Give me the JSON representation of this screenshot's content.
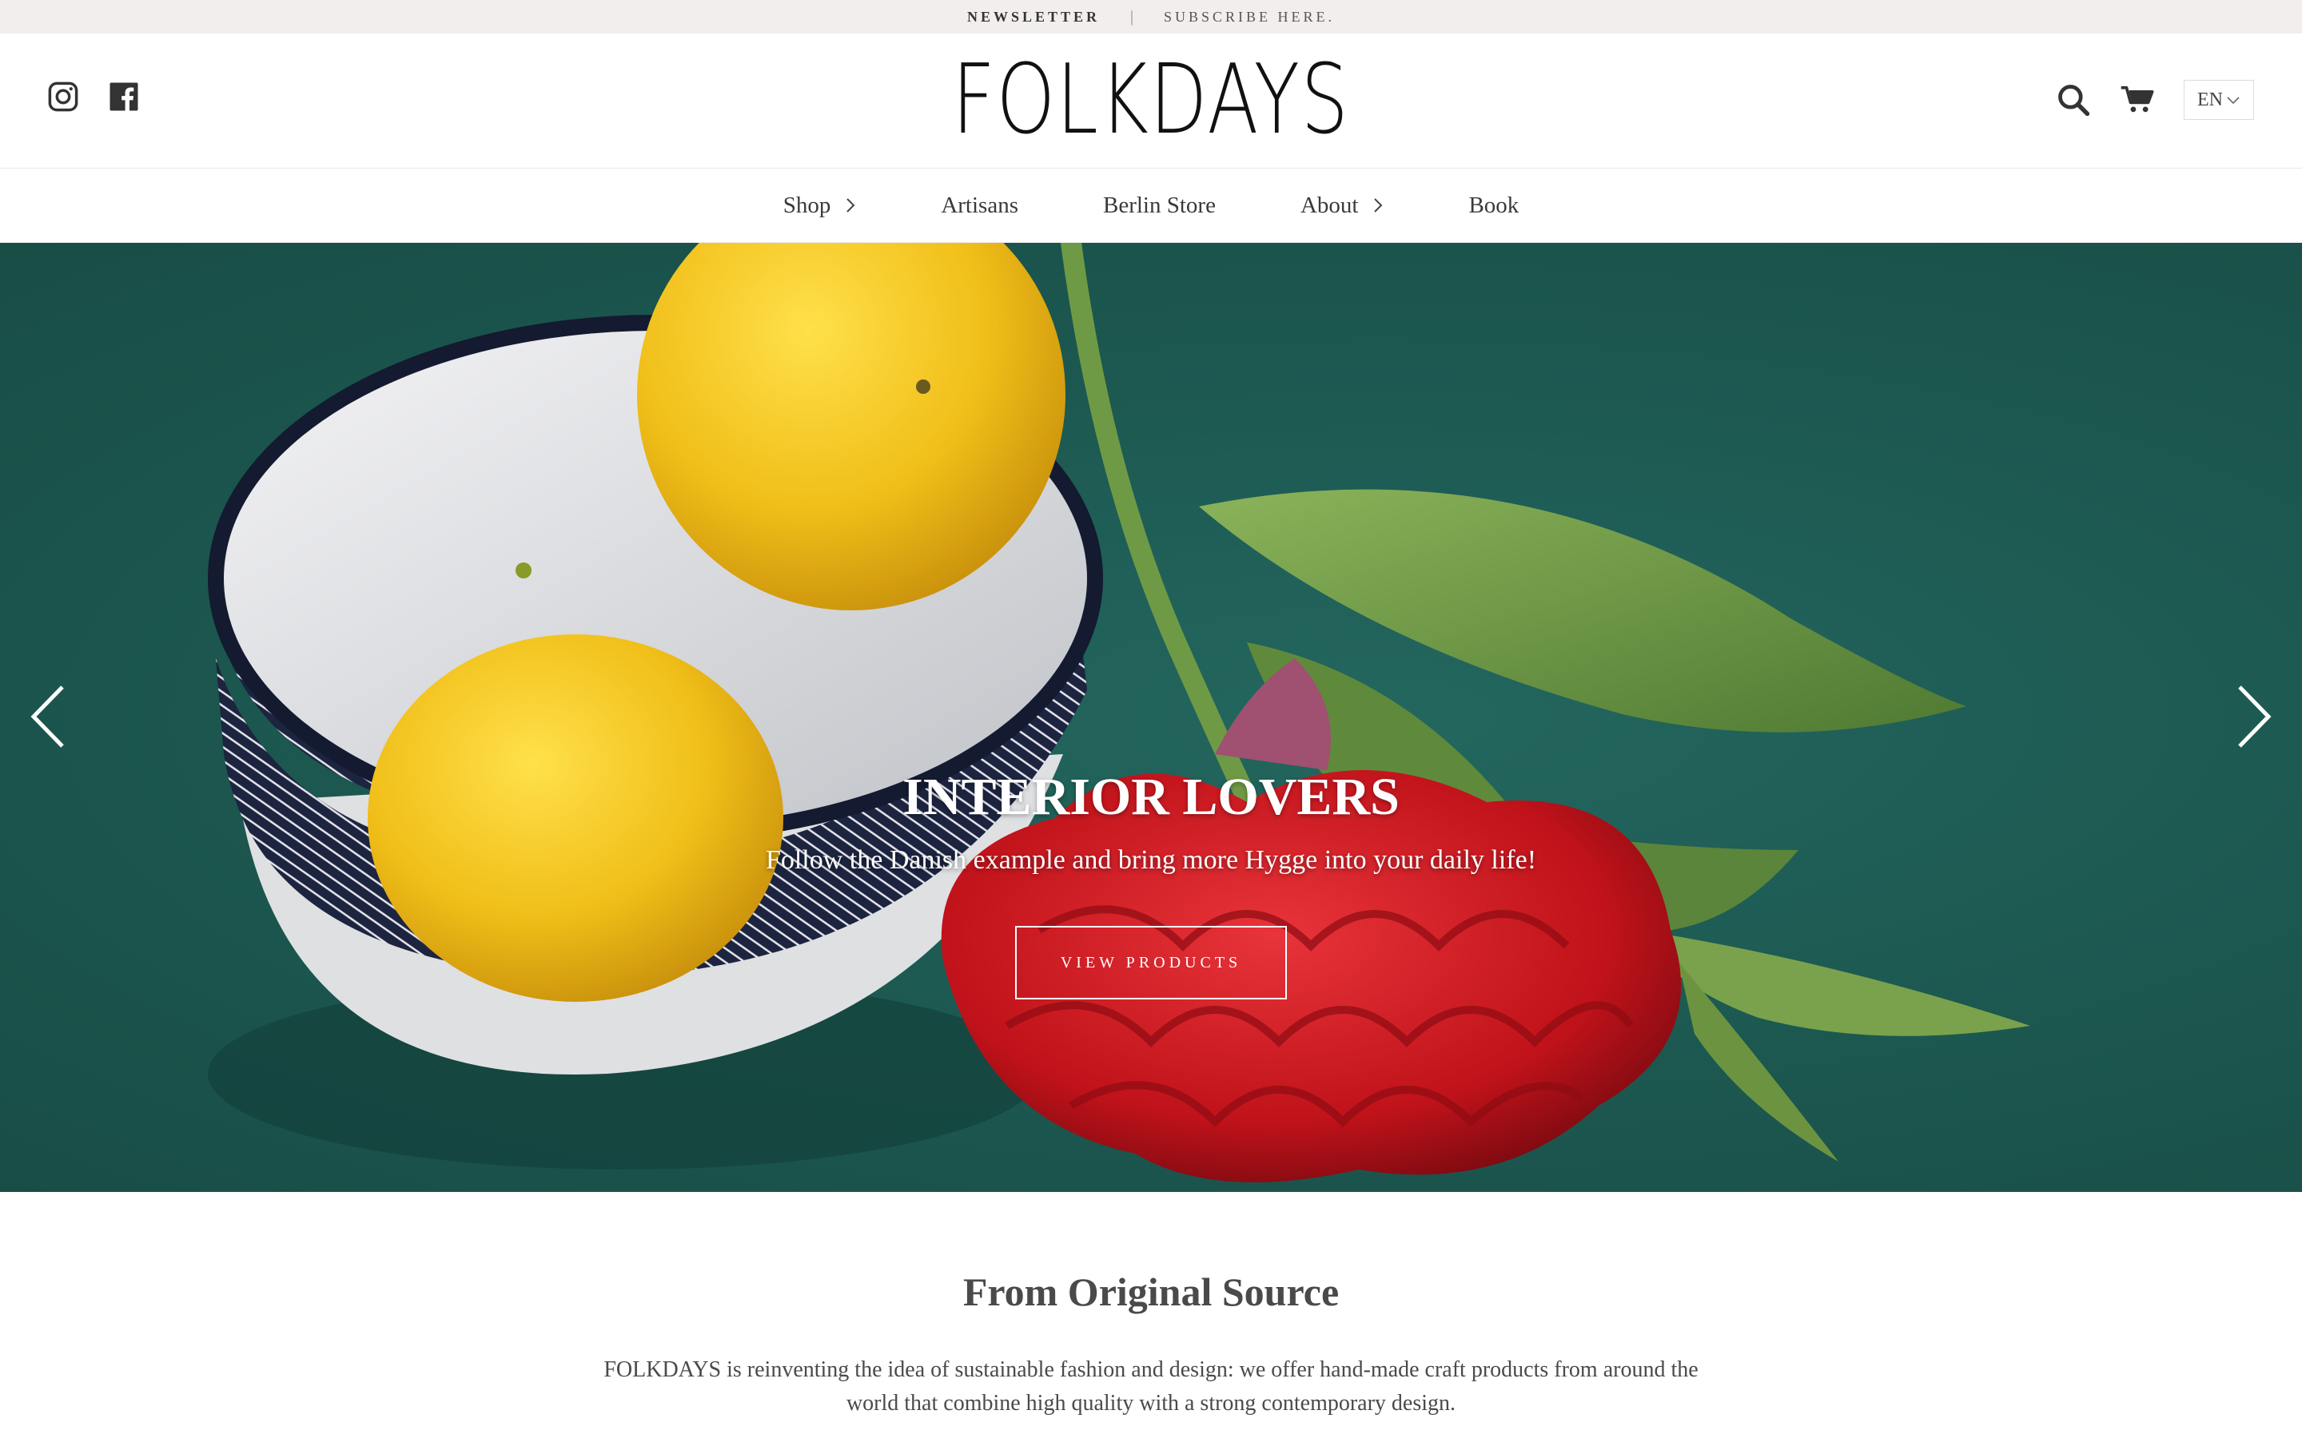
{
  "announcement": {
    "newsletter": "NEWSLETTER",
    "separator": "|",
    "subscribe": "SUBSCRIBE HERE."
  },
  "header": {
    "logo_text": "FOLKDAYS",
    "social": [
      {
        "icon": "instagram-icon"
      },
      {
        "icon": "facebook-icon"
      }
    ],
    "actions": {
      "search_icon": "search-icon",
      "cart_icon": "cart-icon",
      "language": "EN"
    }
  },
  "nav": {
    "items": [
      {
        "label": "Shop",
        "has_submenu": true
      },
      {
        "label": "Artisans",
        "has_submenu": false
      },
      {
        "label": "Berlin Store",
        "has_submenu": false
      },
      {
        "label": "About",
        "has_submenu": true
      },
      {
        "label": "Book",
        "has_submenu": false
      }
    ]
  },
  "hero": {
    "title": "INTERIOR LOVERS",
    "subtitle": "Follow the Danish example and bring more Hygge into your daily life!",
    "button": "VIEW PRODUCTS",
    "colors": {
      "background": "#1f5d55",
      "lemon": "#f2c21b",
      "flower": "#c8161c",
      "leaf": "#6f9a45"
    }
  },
  "intro": {
    "title": "From Original Source",
    "text": "FOLKDAYS is reinventing the idea of sustainable fashion and design: we offer hand-made craft products from around the world that combine high quality with a strong contemporary design."
  }
}
